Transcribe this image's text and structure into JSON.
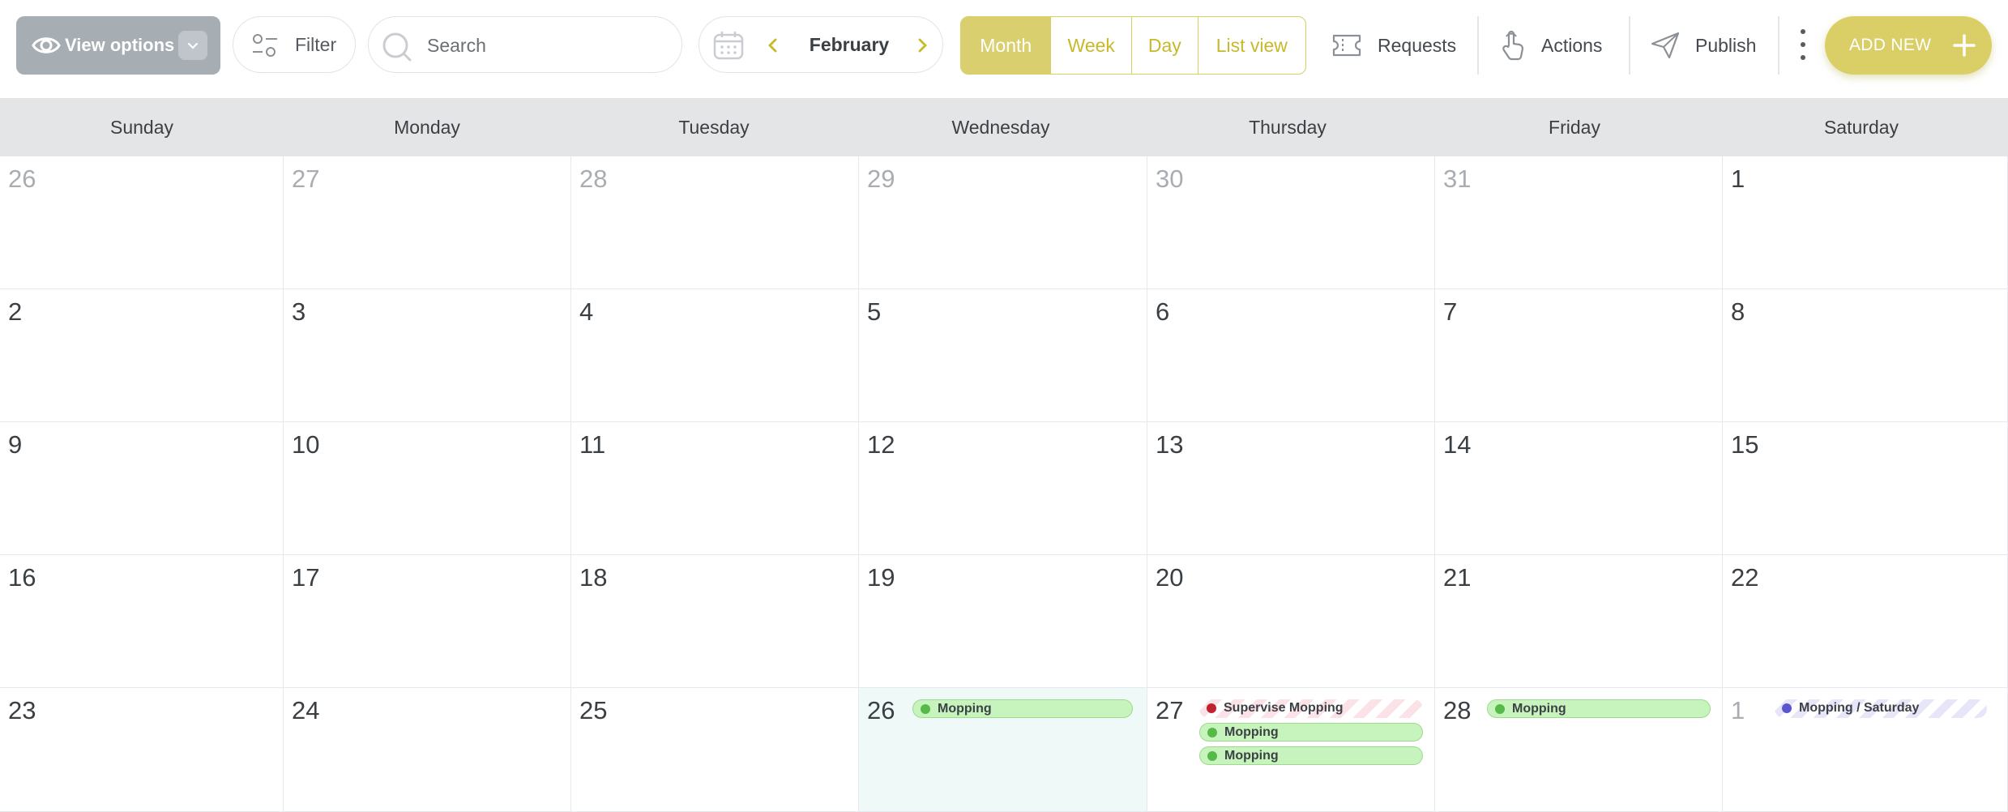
{
  "toolbar": {
    "view_options_label": "View options",
    "filter_label": "Filter",
    "search_placeholder": "Search",
    "month_label": "February",
    "views": [
      {
        "label": "Month",
        "active": true
      },
      {
        "label": "Week",
        "active": false
      },
      {
        "label": "Day",
        "active": false
      },
      {
        "label": "List view",
        "active": false
      }
    ],
    "requests_label": "Requests",
    "actions_label": "Actions",
    "publish_label": "Publish",
    "add_new_label": "ADD NEW",
    "icons": {
      "view_options": "eye-icon",
      "filter": "sliders-icon",
      "search": "search-icon",
      "calendar": "calendar-icon",
      "requests": "ticket-icon",
      "actions": "hand-pointer-icon",
      "publish": "paper-plane-icon",
      "more": "kebab-icon",
      "add": "plus-icon"
    }
  },
  "colors": {
    "accent": "#d9cf6e",
    "accent_text": "#c7b92a",
    "header_bg": "#e4e5e7",
    "today_bg": "#eef9f8",
    "event_green": "#c7f4bd",
    "event_red_dot": "#c0222e",
    "event_blue_dot": "#5b55cf"
  },
  "calendar": {
    "weekdays": [
      "Sunday",
      "Monday",
      "Tuesday",
      "Wednesday",
      "Thursday",
      "Friday",
      "Saturday"
    ],
    "weeks": [
      [
        {
          "day": "26",
          "muted": true
        },
        {
          "day": "27",
          "muted": true
        },
        {
          "day": "28",
          "muted": true
        },
        {
          "day": "29",
          "muted": true
        },
        {
          "day": "30",
          "muted": true
        },
        {
          "day": "31",
          "muted": true
        },
        {
          "day": "1",
          "muted": false
        }
      ],
      [
        {
          "day": "2"
        },
        {
          "day": "3"
        },
        {
          "day": "4"
        },
        {
          "day": "5"
        },
        {
          "day": "6"
        },
        {
          "day": "7"
        },
        {
          "day": "8"
        }
      ],
      [
        {
          "day": "9"
        },
        {
          "day": "10"
        },
        {
          "day": "11"
        },
        {
          "day": "12"
        },
        {
          "day": "13"
        },
        {
          "day": "14"
        },
        {
          "day": "15"
        }
      ],
      [
        {
          "day": "16"
        },
        {
          "day": "17"
        },
        {
          "day": "18"
        },
        {
          "day": "19"
        },
        {
          "day": "20"
        },
        {
          "day": "21"
        },
        {
          "day": "22"
        }
      ],
      [
        {
          "day": "23"
        },
        {
          "day": "24"
        },
        {
          "day": "25"
        },
        {
          "day": "26",
          "today": true,
          "events": [
            {
              "label": "Mopping",
              "style": "green"
            }
          ]
        },
        {
          "day": "27",
          "events": [
            {
              "label": "Supervise Mopping",
              "style": "striped-red"
            },
            {
              "label": "Mopping",
              "style": "green"
            },
            {
              "label": "Mopping",
              "style": "green"
            }
          ]
        },
        {
          "day": "28",
          "events": [
            {
              "label": "Mopping",
              "style": "green"
            }
          ]
        },
        {
          "day": "1",
          "muted": true,
          "events": [
            {
              "label": "Mopping / Saturday",
              "style": "striped-blue"
            }
          ]
        }
      ]
    ]
  }
}
